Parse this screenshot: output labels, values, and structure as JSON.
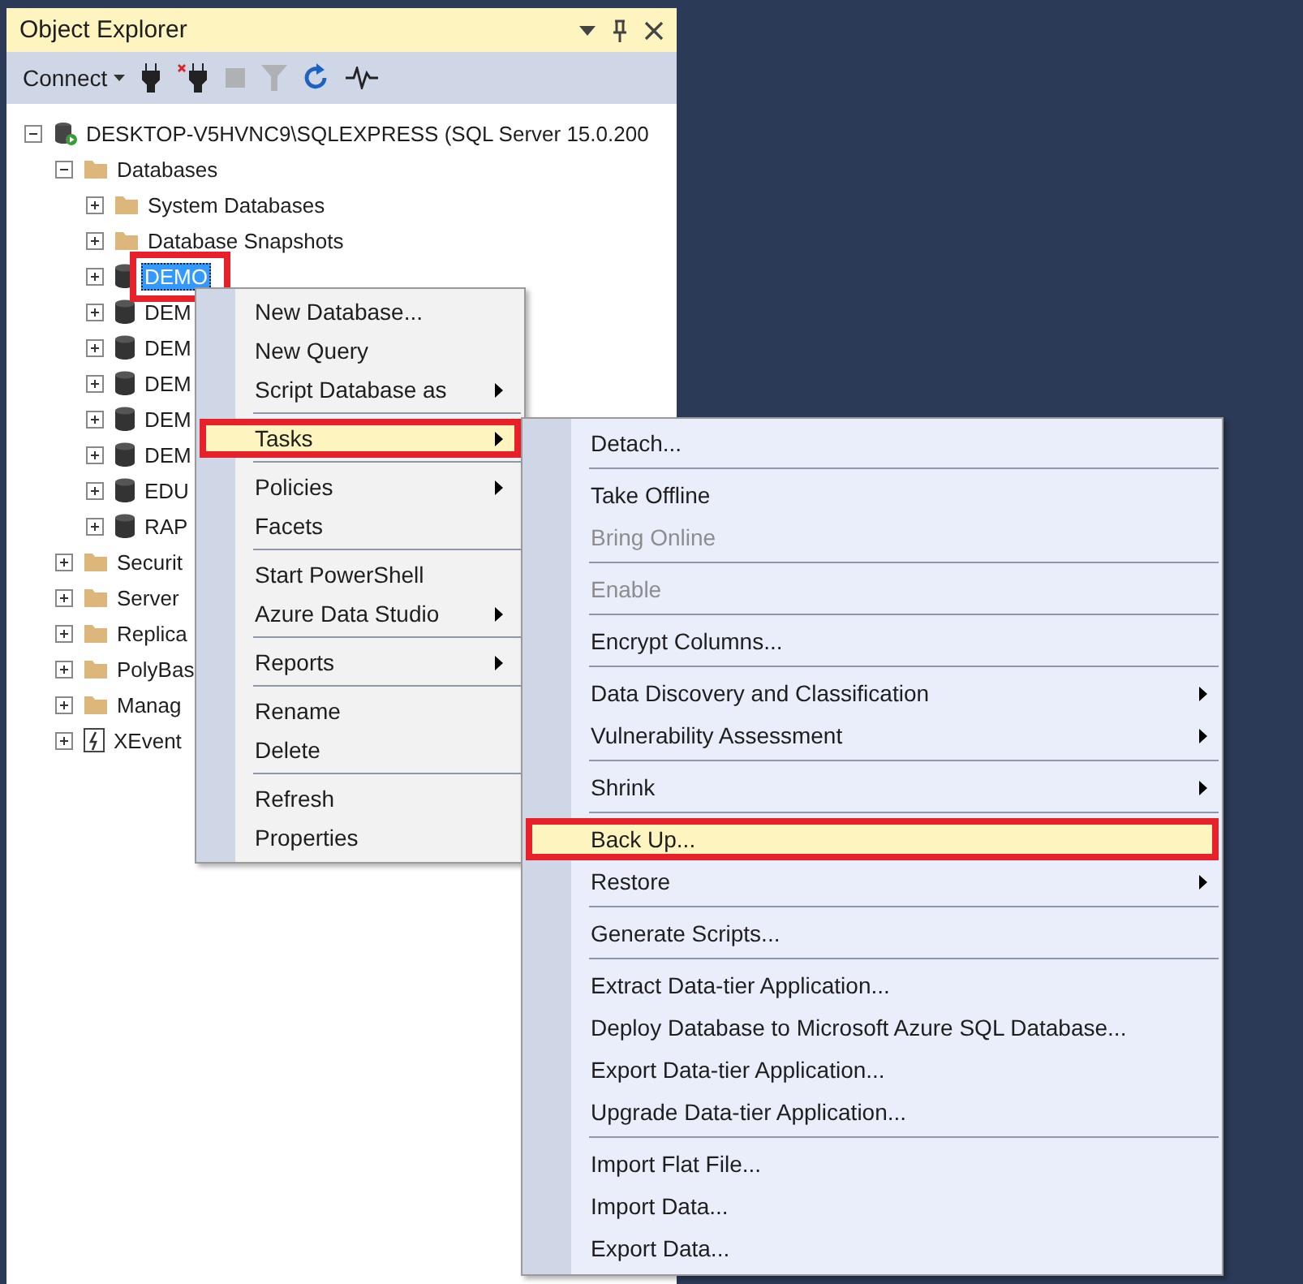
{
  "panel": {
    "title": "Object Explorer",
    "toolbar": [
      {
        "kind": "connect",
        "label": "Connect"
      },
      {
        "kind": "plug",
        "disabled": false
      },
      {
        "kind": "unplug",
        "disabled": false
      },
      {
        "kind": "stop",
        "disabled": true
      },
      {
        "kind": "filter",
        "disabled": true
      },
      {
        "kind": "refresh",
        "disabled": false
      },
      {
        "kind": "activity",
        "disabled": false
      }
    ],
    "tree": [
      {
        "label": "DESKTOP-V5HVNC9\\SQLEXPRESS (SQL Server 15.0.200",
        "kind": "server",
        "expanded": true,
        "selected": false,
        "children": [
          {
            "label": "Databases",
            "kind": "folder",
            "expanded": true,
            "selected": false,
            "children": [
              {
                "label": "System Databases",
                "kind": "folder",
                "expanded": false,
                "selected": false
              },
              {
                "label": "Database Snapshots",
                "kind": "folder",
                "expanded": false,
                "selected": false
              },
              {
                "label": "DEMO",
                "kind": "database",
                "expanded": false,
                "selected": true,
                "annotated": true
              },
              {
                "label": "DEM",
                "kind": "database",
                "expanded": false,
                "selected": false
              },
              {
                "label": "DEM",
                "kind": "database",
                "expanded": false,
                "selected": false
              },
              {
                "label": "DEM",
                "kind": "database",
                "expanded": false,
                "selected": false
              },
              {
                "label": "DEM",
                "kind": "database",
                "expanded": false,
                "selected": false
              },
              {
                "label": "DEM",
                "kind": "database",
                "expanded": false,
                "selected": false
              },
              {
                "label": "EDU",
                "kind": "database",
                "expanded": false,
                "selected": false
              },
              {
                "label": "RAP",
                "kind": "database",
                "expanded": false,
                "selected": false
              }
            ]
          },
          {
            "label": "Securit",
            "kind": "folder",
            "expanded": false,
            "selected": false
          },
          {
            "label": "Server",
            "kind": "folder",
            "expanded": false,
            "selected": false
          },
          {
            "label": "Replica",
            "kind": "folder",
            "expanded": false,
            "selected": false
          },
          {
            "label": "PolyBas",
            "kind": "folder",
            "expanded": false,
            "selected": false
          },
          {
            "label": "Manag",
            "kind": "folder",
            "expanded": false,
            "selected": false
          },
          {
            "label": "XEvent",
            "kind": "xevent",
            "expanded": false,
            "selected": false
          }
        ]
      }
    ]
  },
  "context_menu": {
    "items": [
      {
        "kind": "item",
        "label": "New Database...",
        "submenu": false,
        "disabled": false,
        "selected": false
      },
      {
        "kind": "item",
        "label": "New Query",
        "submenu": false,
        "disabled": false,
        "selected": false
      },
      {
        "kind": "item",
        "label": "Script Database as",
        "submenu": true,
        "disabled": false,
        "selected": false
      },
      {
        "kind": "separator"
      },
      {
        "kind": "item",
        "label": "Tasks",
        "submenu": true,
        "disabled": false,
        "selected": true,
        "annotated": true
      },
      {
        "kind": "separator"
      },
      {
        "kind": "item",
        "label": "Policies",
        "submenu": true,
        "disabled": false,
        "selected": false
      },
      {
        "kind": "item",
        "label": "Facets",
        "submenu": false,
        "disabled": false,
        "selected": false
      },
      {
        "kind": "separator"
      },
      {
        "kind": "item",
        "label": "Start PowerShell",
        "submenu": false,
        "disabled": false,
        "selected": false
      },
      {
        "kind": "item",
        "label": "Azure Data Studio",
        "submenu": true,
        "disabled": false,
        "selected": false
      },
      {
        "kind": "separator"
      },
      {
        "kind": "item",
        "label": "Reports",
        "submenu": true,
        "disabled": false,
        "selected": false
      },
      {
        "kind": "separator"
      },
      {
        "kind": "item",
        "label": "Rename",
        "submenu": false,
        "disabled": false,
        "selected": false
      },
      {
        "kind": "item",
        "label": "Delete",
        "submenu": false,
        "disabled": false,
        "selected": false
      },
      {
        "kind": "separator"
      },
      {
        "kind": "item",
        "label": "Refresh",
        "submenu": false,
        "disabled": false,
        "selected": false
      },
      {
        "kind": "item",
        "label": "Properties",
        "submenu": false,
        "disabled": false,
        "selected": false
      }
    ]
  },
  "tasks_submenu": {
    "items": [
      {
        "kind": "item",
        "label": "Detach...",
        "submenu": false,
        "disabled": false,
        "selected": false
      },
      {
        "kind": "separator"
      },
      {
        "kind": "item",
        "label": "Take Offline",
        "submenu": false,
        "disabled": false,
        "selected": false
      },
      {
        "kind": "item",
        "label": "Bring Online",
        "submenu": false,
        "disabled": true,
        "selected": false
      },
      {
        "kind": "separator"
      },
      {
        "kind": "item",
        "label": "Enable",
        "submenu": false,
        "disabled": true,
        "selected": false
      },
      {
        "kind": "separator"
      },
      {
        "kind": "item",
        "label": "Encrypt Columns...",
        "submenu": false,
        "disabled": false,
        "selected": false
      },
      {
        "kind": "separator"
      },
      {
        "kind": "item",
        "label": "Data Discovery and Classification",
        "submenu": true,
        "disabled": false,
        "selected": false
      },
      {
        "kind": "item",
        "label": "Vulnerability Assessment",
        "submenu": true,
        "disabled": false,
        "selected": false
      },
      {
        "kind": "separator"
      },
      {
        "kind": "item",
        "label": "Shrink",
        "submenu": true,
        "disabled": false,
        "selected": false
      },
      {
        "kind": "separator"
      },
      {
        "kind": "item",
        "label": "Back Up...",
        "submenu": false,
        "disabled": false,
        "selected": true,
        "annotated": true
      },
      {
        "kind": "item",
        "label": "Restore",
        "submenu": true,
        "disabled": false,
        "selected": false
      },
      {
        "kind": "separator"
      },
      {
        "kind": "item",
        "label": "Generate Scripts...",
        "submenu": false,
        "disabled": false,
        "selected": false
      },
      {
        "kind": "separator"
      },
      {
        "kind": "item",
        "label": "Extract Data-tier Application...",
        "submenu": false,
        "disabled": false,
        "selected": false
      },
      {
        "kind": "item",
        "label": "Deploy Database to Microsoft Azure SQL Database...",
        "submenu": false,
        "disabled": false,
        "selected": false
      },
      {
        "kind": "item",
        "label": "Export Data-tier Application...",
        "submenu": false,
        "disabled": false,
        "selected": false
      },
      {
        "kind": "item",
        "label": "Upgrade Data-tier Application...",
        "submenu": false,
        "disabled": false,
        "selected": false
      },
      {
        "kind": "separator"
      },
      {
        "kind": "item",
        "label": "Import Flat File...",
        "submenu": false,
        "disabled": false,
        "selected": false
      },
      {
        "kind": "item",
        "label": "Import Data...",
        "submenu": false,
        "disabled": false,
        "selected": false
      },
      {
        "kind": "item",
        "label": "Export Data...",
        "submenu": false,
        "disabled": false,
        "selected": false
      }
    ]
  }
}
